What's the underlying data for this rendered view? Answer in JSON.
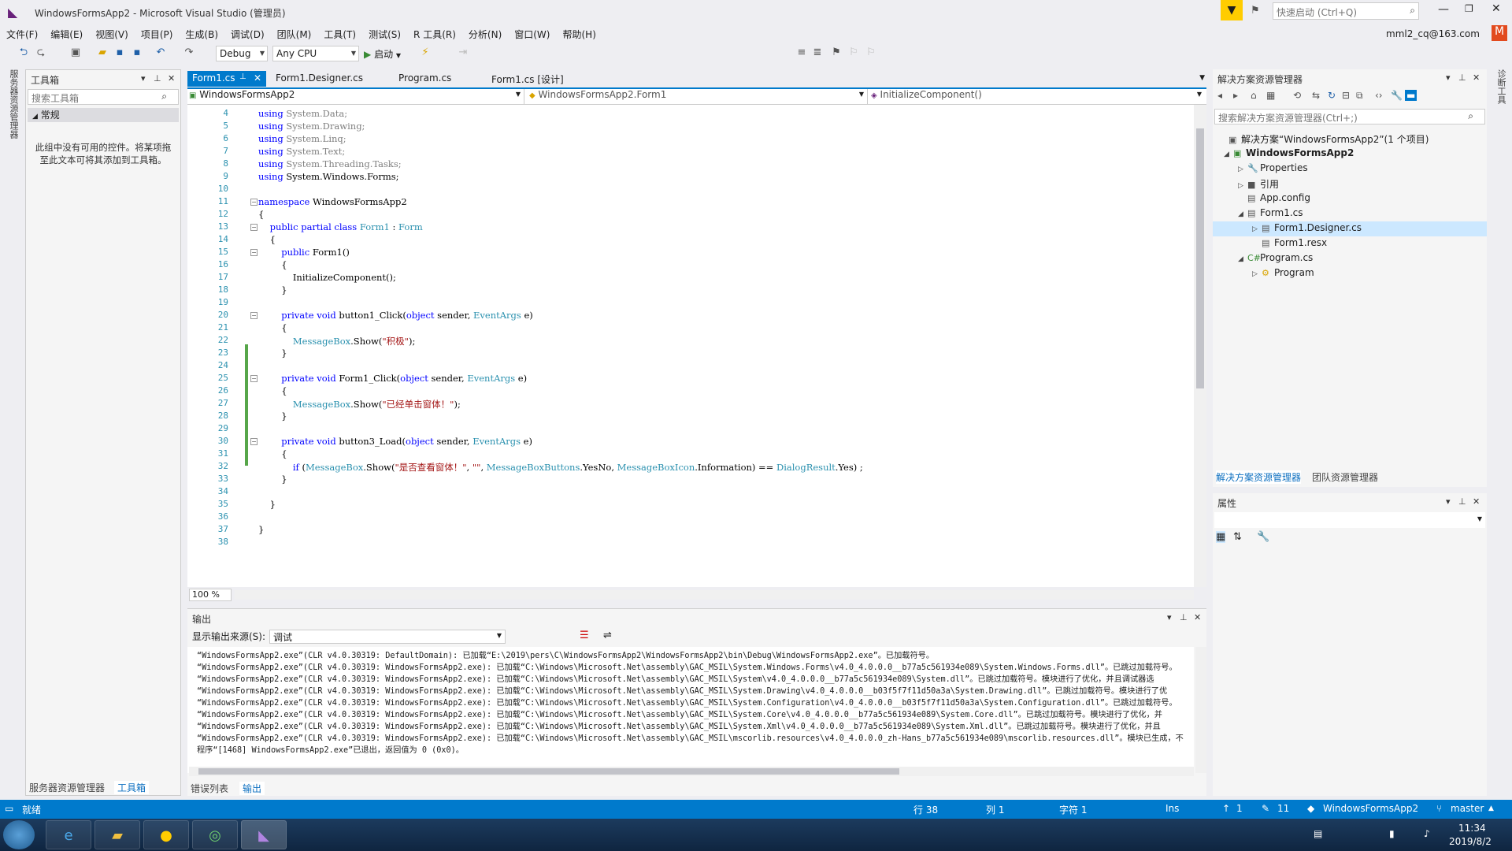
{
  "window": {
    "title": "WindowsFormsApp2 - Microsoft Visual Studio (管理员)",
    "quick_launch_placeholder": "快速启动 (Ctrl+Q)",
    "account": "mml2_cq@163.com",
    "account_initial": "M"
  },
  "menu": [
    "文件(F)",
    "编辑(E)",
    "视图(V)",
    "项目(P)",
    "生成(B)",
    "调试(D)",
    "团队(M)",
    "工具(T)",
    "测试(S)",
    "R 工具(R)",
    "分析(N)",
    "窗口(W)",
    "帮助(H)"
  ],
  "toolbar": {
    "config": "Debug",
    "platform": "Any CPU",
    "start_label": "启动"
  },
  "left_strip": {
    "server_explorer_tab": "服务器资源管理器",
    "toolbox_tab": "工具箱"
  },
  "right_strip": {
    "tab": "诊断工具"
  },
  "toolbox": {
    "title": "工具箱",
    "search_placeholder": "搜索工具箱",
    "group": "常规",
    "empty_text": "此组中没有可用的控件。将某项拖至此文本可将其添加到工具箱。",
    "bottom_tabs": [
      "服务器资源管理器",
      "工具箱"
    ]
  },
  "editor": {
    "tabs": [
      "Form1.cs",
      "Form1.Designer.cs",
      "Program.cs",
      "Form1.cs [设计]"
    ],
    "nav_project": "WindowsFormsApp2",
    "nav_class": "WindowsFormsApp2.Form1",
    "nav_member": "InitializeComponent()",
    "zoom": "100 %",
    "lines": [
      {
        "n": "4",
        "html": "<span class='kw'>using</span> <span class='gray'>System.Data;</span>"
      },
      {
        "n": "5",
        "html": "<span class='kw'>using</span> <span class='gray'>System.Drawing;</span>"
      },
      {
        "n": "6",
        "html": "<span class='kw'>using</span> <span class='gray'>System.Linq;</span>"
      },
      {
        "n": "7",
        "html": "<span class='kw'>using</span> <span class='gray'>System.Text;</span>"
      },
      {
        "n": "8",
        "html": "<span class='kw'>using</span> <span class='gray'>System.Threading.Tasks;</span>"
      },
      {
        "n": "9",
        "html": "<span class='kw'>using</span> System.Windows.Forms;"
      },
      {
        "n": "10",
        "html": ""
      },
      {
        "n": "11",
        "html": "<span class='kw'>namespace</span> WindowsFormsApp2"
      },
      {
        "n": "12",
        "html": "{"
      },
      {
        "n": "13",
        "html": "    <span class='kw'>public partial class</span> <span class='ty'>Form1</span> : <span class='ty'>Form</span>"
      },
      {
        "n": "14",
        "html": "    {"
      },
      {
        "n": "15",
        "html": "        <span class='kw'>public</span> Form1()"
      },
      {
        "n": "16",
        "html": "        {"
      },
      {
        "n": "17",
        "html": "            InitializeComponent();"
      },
      {
        "n": "18",
        "html": "        }"
      },
      {
        "n": "19",
        "html": ""
      },
      {
        "n": "20",
        "html": "        <span class='kw'>private void</span> button1_Click(<span class='kw'>object</span> sender, <span class='ty'>EventArgs</span> e)"
      },
      {
        "n": "21",
        "html": "        {"
      },
      {
        "n": "22",
        "html": "            <span class='ty'>MessageBox</span>.Show(<span class='str'>\"积极\"</span>);"
      },
      {
        "n": "23",
        "html": "        }"
      },
      {
        "n": "24",
        "html": ""
      },
      {
        "n": "25",
        "html": "        <span class='kw'>private void</span> Form1_Click(<span class='kw'>object</span> sender, <span class='ty'>EventArgs</span> e)"
      },
      {
        "n": "26",
        "html": "        {"
      },
      {
        "n": "27",
        "html": "            <span class='ty'>MessageBox</span>.Show(<span class='str'>\"已经单击窗体！\"</span>);"
      },
      {
        "n": "28",
        "html": "        }"
      },
      {
        "n": "29",
        "html": ""
      },
      {
        "n": "30",
        "html": "        <span class='kw'>private void</span> button3_Load(<span class='kw'>object</span> sender, <span class='ty'>EventArgs</span> e)"
      },
      {
        "n": "31",
        "html": "        {"
      },
      {
        "n": "32",
        "html": "            <span class='kw'>if</span> (<span class='ty'>MessageBox</span>.Show(<span class='str'>\"是否查看窗体！\"</span>, <span class='str'>\"\"</span>, <span class='ty'>MessageBoxButtons</span>.YesNo, <span class='ty'>MessageBoxIcon</span>.Information) == <span class='ty'>DialogResult</span>.Yes) ;"
      },
      {
        "n": "33",
        "html": "        }"
      },
      {
        "n": "34",
        "html": ""
      },
      {
        "n": "35",
        "html": "    }"
      },
      {
        "n": "36",
        "html": ""
      },
      {
        "n": "37",
        "html": "}"
      },
      {
        "n": "38",
        "html": ""
      }
    ]
  },
  "output": {
    "title": "输出",
    "source_label": "显示输出来源(S):",
    "source_value": "调试",
    "lines": [
      "“WindowsFormsApp2.exe”(CLR v4.0.30319: DefaultDomain): 已加载“E:\\2019\\pers\\C\\WindowsFormsApp2\\WindowsFormsApp2\\bin\\Debug\\WindowsFormsApp2.exe”。已加载符号。",
      "“WindowsFormsApp2.exe”(CLR v4.0.30319: WindowsFormsApp2.exe): 已加载“C:\\Windows\\Microsoft.Net\\assembly\\GAC_MSIL\\System.Windows.Forms\\v4.0_4.0.0.0__b77a5c561934e089\\System.Windows.Forms.dll”。已跳过加载符号。",
      "“WindowsFormsApp2.exe”(CLR v4.0.30319: WindowsFormsApp2.exe): 已加载“C:\\Windows\\Microsoft.Net\\assembly\\GAC_MSIL\\System\\v4.0_4.0.0.0__b77a5c561934e089\\System.dll”。已跳过加载符号。模块进行了优化，并且调试器选",
      "“WindowsFormsApp2.exe”(CLR v4.0.30319: WindowsFormsApp2.exe): 已加载“C:\\Windows\\Microsoft.Net\\assembly\\GAC_MSIL\\System.Drawing\\v4.0_4.0.0.0__b03f5f7f11d50a3a\\System.Drawing.dll”。已跳过加载符号。模块进行了优",
      "“WindowsFormsApp2.exe”(CLR v4.0.30319: WindowsFormsApp2.exe): 已加载“C:\\Windows\\Microsoft.Net\\assembly\\GAC_MSIL\\System.Configuration\\v4.0_4.0.0.0__b03f5f7f11d50a3a\\System.Configuration.dll”。已跳过加载符号。",
      "“WindowsFormsApp2.exe”(CLR v4.0.30319: WindowsFormsApp2.exe): 已加载“C:\\Windows\\Microsoft.Net\\assembly\\GAC_MSIL\\System.Core\\v4.0_4.0.0.0__b77a5c561934e089\\System.Core.dll”。已跳过加载符号。模块进行了优化，并",
      "“WindowsFormsApp2.exe”(CLR v4.0.30319: WindowsFormsApp2.exe): 已加载“C:\\Windows\\Microsoft.Net\\assembly\\GAC_MSIL\\System.Xml\\v4.0_4.0.0.0__b77a5c561934e089\\System.Xml.dll”。已跳过加载符号。模块进行了优化，并且",
      "“WindowsFormsApp2.exe”(CLR v4.0.30319: WindowsFormsApp2.exe): 已加载“C:\\Windows\\Microsoft.Net\\assembly\\GAC_MSIL\\mscorlib.resources\\v4.0_4.0.0.0_zh-Hans_b77a5c561934e089\\mscorlib.resources.dll”。模块已生成，不",
      "程序“[1468] WindowsFormsApp2.exe”已退出，返回值为 0 (0x0)。"
    ],
    "bottom_tabs": [
      "错误列表",
      "输出"
    ]
  },
  "solution_explorer": {
    "title": "解决方案资源管理器",
    "search_placeholder": "搜索解决方案资源管理器(Ctrl+;)",
    "items": [
      {
        "label": "解决方案“WindowsFormsApp2”(1 个项目)",
        "icon": "📁"
      },
      {
        "label": "WindowsFormsApp2",
        "icon": "C#"
      },
      {
        "label": "Properties",
        "icon": "🔧"
      },
      {
        "label": "引用",
        "icon": "■"
      },
      {
        "label": "App.config",
        "icon": "📄"
      },
      {
        "label": "Form1.cs",
        "icon": "▤"
      },
      {
        "label": "Form1.Designer.cs",
        "icon": "📄"
      },
      {
        "label": "Form1.resx",
        "icon": "📄"
      },
      {
        "label": "Program.cs",
        "icon": "C#"
      },
      {
        "label": "Program",
        "icon": "⚙"
      }
    ],
    "bottom_tabs": [
      "解决方案资源管理器",
      "团队资源管理器"
    ]
  },
  "properties": {
    "title": "属性"
  },
  "status": {
    "ready": "就绪",
    "row": "行 38",
    "col": "列 1",
    "char": "字符 1",
    "ins": "Ins",
    "up": "1",
    "pencil": "11",
    "repo": "WindowsFormsApp2",
    "branch": "master"
  },
  "taskbar": {
    "time": "11:34",
    "date": "2019/8/2"
  }
}
